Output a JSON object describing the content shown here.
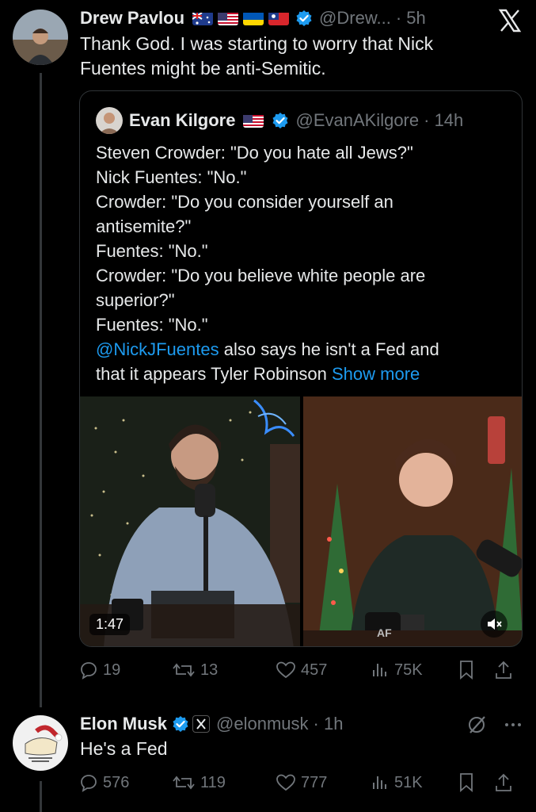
{
  "tweet1": {
    "name": "Drew Pavlou",
    "handle": "@Drew...",
    "time": "· 5h",
    "text": "Thank God. I was starting to worry that Nick Fuentes might be anti-Semitic."
  },
  "quote": {
    "name": "Evan Kilgore",
    "handle": "@EvanAKilgore",
    "time": "· 14h",
    "lines": [
      "Steven Crowder: \"Do you hate all Jews?\"",
      "Nick Fuentes: \"No.\"",
      "Crowder: \"Do you consider yourself an",
      "antisemite?\"",
      "Fuentes: \"No.\"",
      "Crowder: \"Do you believe white people are",
      "superior?\"",
      "Fuentes: \"No.\""
    ],
    "mention": "@NickJFuentes",
    "mention_rest": " also says he isn't a Fed and",
    "last_line": "that it appears Tyler Robinson ",
    "show_more": "Show more",
    "video_duration": "1:47",
    "mug_logo": "AF"
  },
  "tweet1_actions": {
    "replies": "19",
    "reposts": "13",
    "likes": "457",
    "views": "75K"
  },
  "tweet2": {
    "name": "Elon Musk",
    "handle": "@elonmusk",
    "time": "· 1h",
    "text": "He's a Fed"
  },
  "tweet2_actions": {
    "replies": "576",
    "reposts": "119",
    "likes": "777",
    "views": "51K"
  },
  "colors": {
    "background": "#000000",
    "text": "#e7e9ea",
    "muted": "#71767b",
    "link": "#1d9bf0",
    "verified": "#1d9bf0",
    "border": "#2f3336"
  }
}
